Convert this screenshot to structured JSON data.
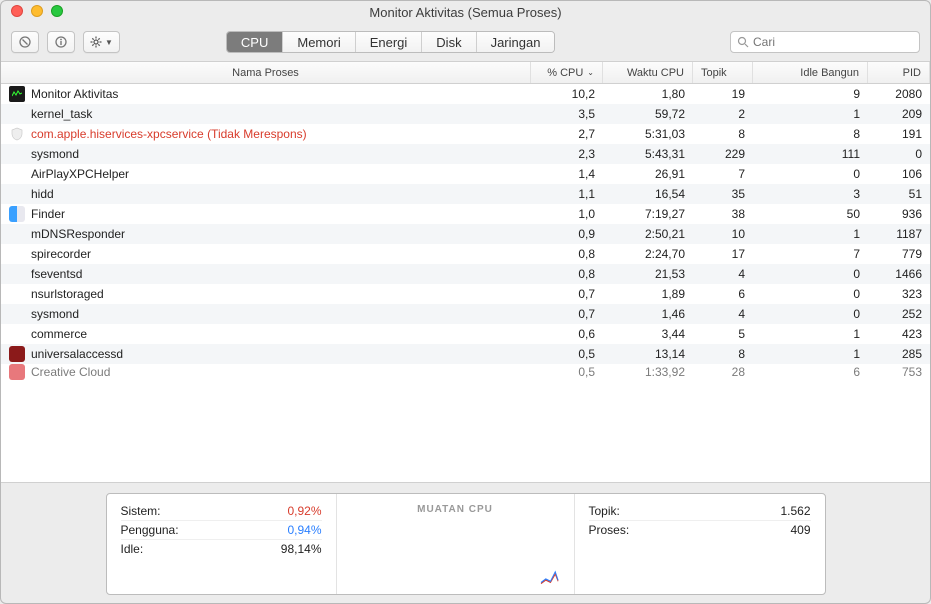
{
  "window": {
    "title": "Monitor Aktivitas (Semua Proses)"
  },
  "tabs": {
    "cpu": "CPU",
    "memory": "Memori",
    "energy": "Energi",
    "disk": "Disk",
    "network": "Jaringan"
  },
  "search": {
    "placeholder": "Cari"
  },
  "columns": {
    "name": "Nama Proses",
    "cpu": "% CPU",
    "time": "Waktu CPU",
    "topik": "Topik",
    "idle": "Idle Bangun",
    "pid": "PID"
  },
  "rows": [
    {
      "icon": "monitor",
      "name": "Monitor Aktivitas",
      "cpu": "10,2",
      "time": "1,80",
      "topik": "19",
      "idle": "9",
      "pid": "2080"
    },
    {
      "icon": "none",
      "name": "kernel_task",
      "cpu": "3,5",
      "time": "59,72",
      "topik": "2",
      "idle": "1",
      "pid": "209"
    },
    {
      "icon": "shield",
      "name": "com.apple.hiservices-xpcservice (Tidak Merespons)",
      "cpu": "2,7",
      "time": "5:31,03",
      "topik": "8",
      "idle": "8",
      "pid": "191",
      "notresp": true
    },
    {
      "icon": "none",
      "name": "sysmond",
      "cpu": "2,3",
      "time": "5:43,31",
      "topik": "229",
      "idle": "111",
      "pid": "0"
    },
    {
      "icon": "none",
      "name": "AirPlayXPCHelper",
      "cpu": "1,4",
      "time": "26,91",
      "topik": "7",
      "idle": "0",
      "pid": "106"
    },
    {
      "icon": "none",
      "name": "hidd",
      "cpu": "1,1",
      "time": "16,54",
      "topik": "35",
      "idle": "3",
      "pid": "51"
    },
    {
      "icon": "finder",
      "name": "Finder",
      "cpu": "1,0",
      "time": "7:19,27",
      "topik": "38",
      "idle": "50",
      "pid": "936"
    },
    {
      "icon": "none",
      "name": "mDNSResponder",
      "cpu": "0,9",
      "time": "2:50,21",
      "topik": "10",
      "idle": "1",
      "pid": "1187"
    },
    {
      "icon": "none",
      "name": "spirecorder",
      "cpu": "0,8",
      "time": "2:24,70",
      "topik": "17",
      "idle": "7",
      "pid": "779"
    },
    {
      "icon": "none",
      "name": "fseventsd",
      "cpu": "0,8",
      "time": "21,53",
      "topik": "4",
      "idle": "0",
      "pid": "1466"
    },
    {
      "icon": "none",
      "name": "nsurlstoraged",
      "cpu": "0,7",
      "time": "1,89",
      "topik": "6",
      "idle": "0",
      "pid": "323"
    },
    {
      "icon": "none",
      "name": "sysmond",
      "cpu": "0,7",
      "time": "1,46",
      "topik": "4",
      "idle": "0",
      "pid": "252"
    },
    {
      "icon": "none",
      "name": "commerce",
      "cpu": "0,6",
      "time": "3,44",
      "topik": "5",
      "idle": "1",
      "pid": "423"
    },
    {
      "icon": "red",
      "name": "universalaccessd",
      "cpu": "0,5",
      "time": "13,14",
      "topik": "8",
      "idle": "1",
      "pid": "285"
    },
    {
      "icon": "cc",
      "name": "Creative Cloud",
      "cpu": "0,5",
      "time": "1:33,92",
      "topik": "28",
      "idle": "6",
      "pid": "753",
      "cut": true
    }
  ],
  "footer": {
    "left": [
      {
        "label": "Sistem:",
        "value": "0,92%",
        "cls": "v-sys"
      },
      {
        "label": "Pengguna:",
        "value": "0,94%",
        "cls": "v-user"
      },
      {
        "label": "Idle:",
        "value": "98,14%",
        "cls": ""
      }
    ],
    "midTitle": "MUATAN CPU",
    "right": [
      {
        "label": "Topik:",
        "value": "1.562"
      },
      {
        "label": "Proses:",
        "value": "409"
      }
    ]
  }
}
